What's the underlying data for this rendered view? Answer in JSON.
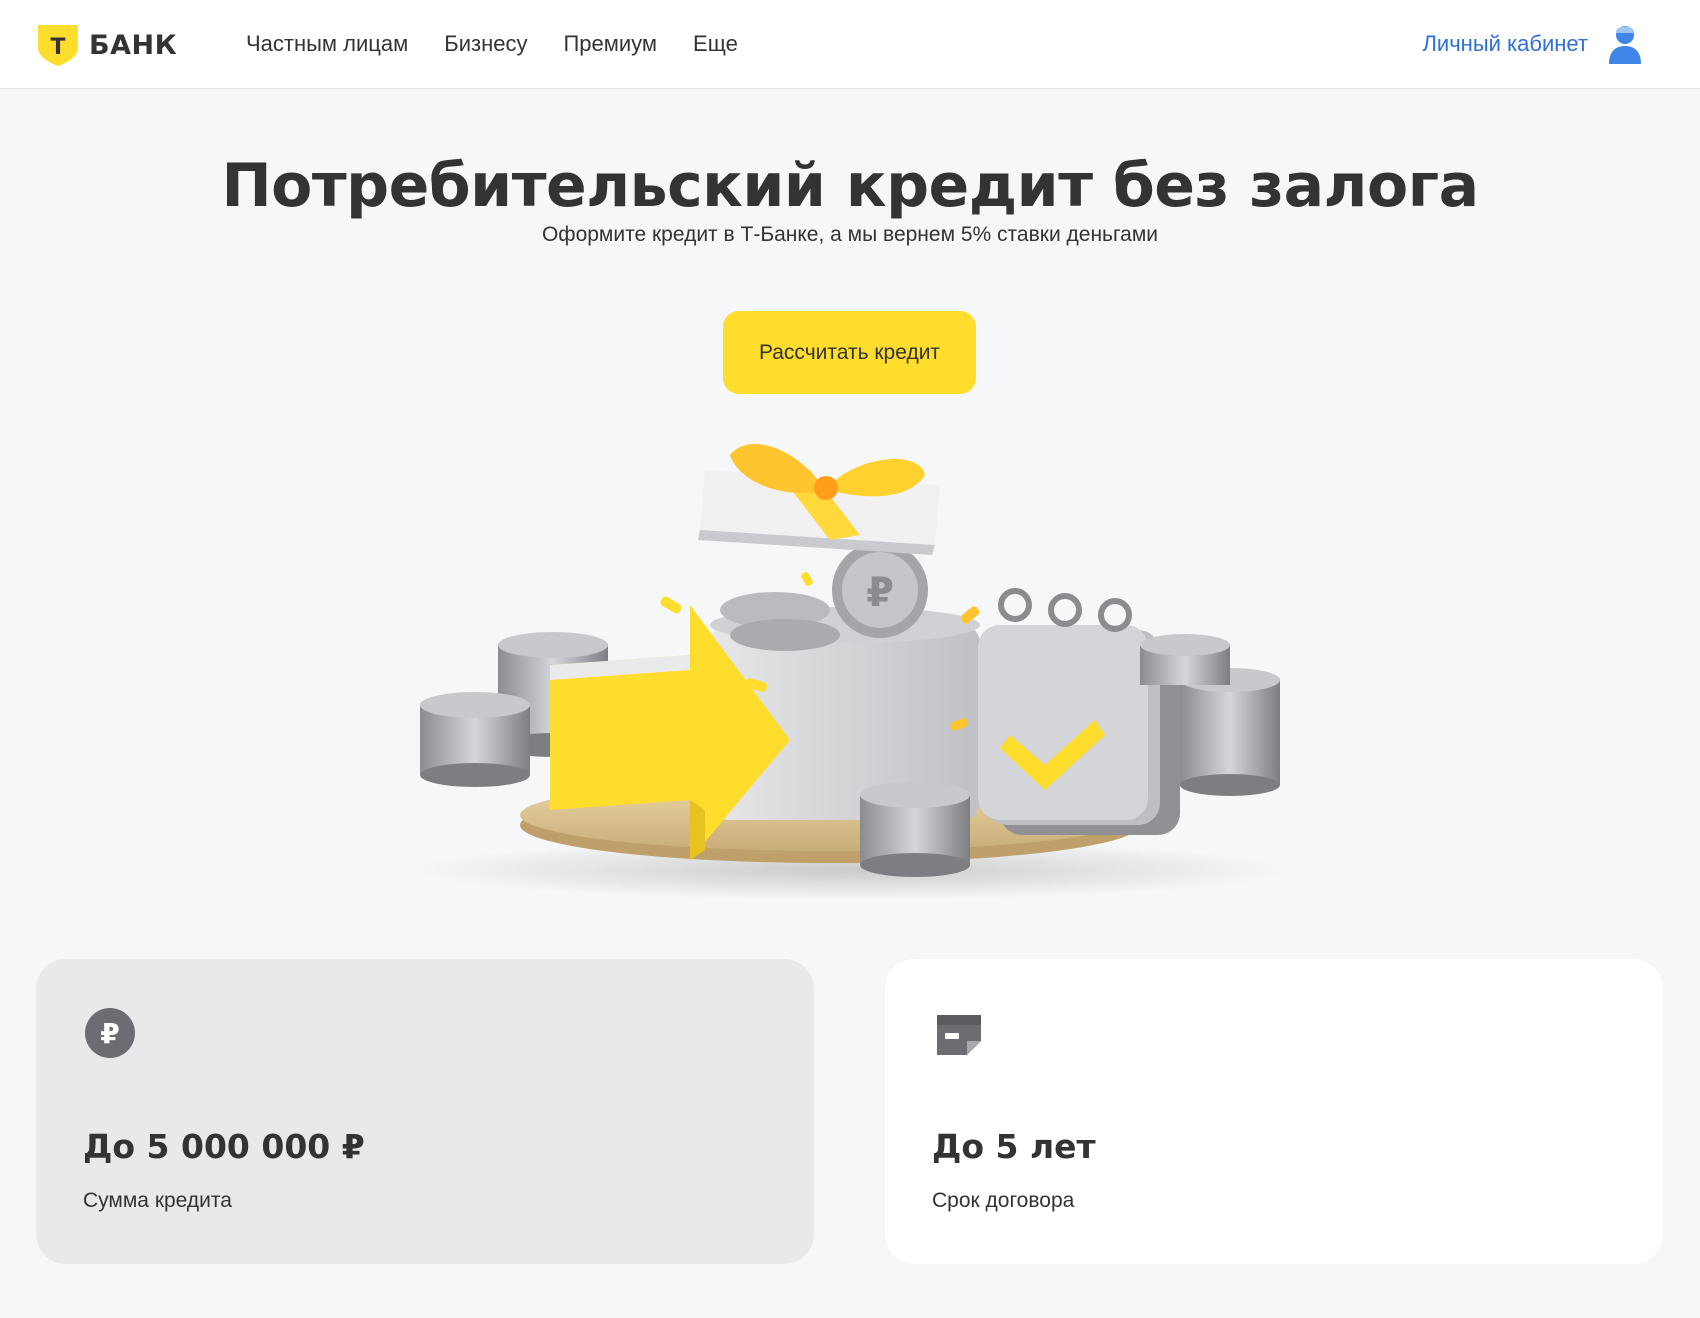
{
  "brand": {
    "logo_letter": "Т",
    "name": "БАНК",
    "colors": {
      "accent": "#ffdd2d",
      "link": "#2f6fd8",
      "text": "#333333",
      "page_bg": "#f6f7f8"
    }
  },
  "header": {
    "nav": [
      "Частным лицам",
      "Бизнесу",
      "Премиум",
      "Еще"
    ],
    "account_label": "Личный кабинет",
    "account_icon": "user-icon"
  },
  "hero": {
    "title": "Потребительский кредит без залога",
    "subtitle": "Оформите кредит в Т-Банке, а мы вернем 5% ставки деньгами",
    "cta_label": "Рассчитать кредит",
    "illustration": "gift-box-coins-calendar-illustration"
  },
  "features": [
    {
      "icon": "ruble-coin-icon",
      "value": "До 5 000 000 ₽",
      "label": "Сумма кредита"
    },
    {
      "icon": "calendar-page-icon",
      "value": "До 5 лет",
      "label": "Срок договора"
    }
  ]
}
